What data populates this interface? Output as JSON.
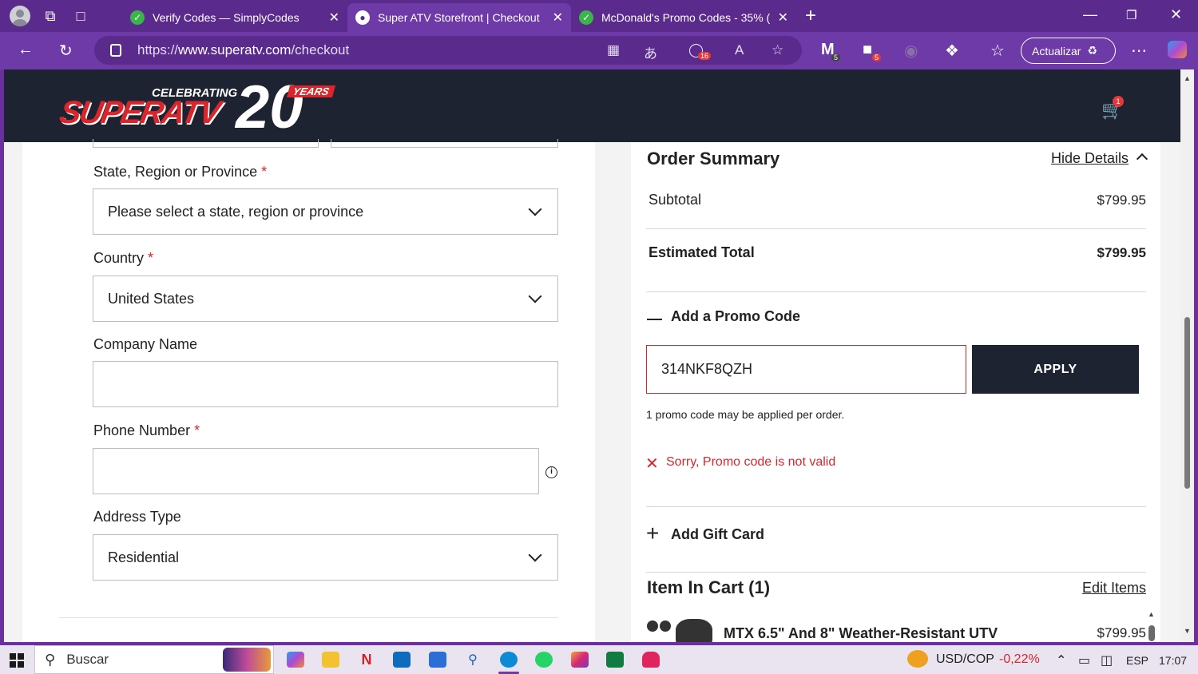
{
  "browser": {
    "tabs": [
      {
        "title": "Verify Codes — SimplyCodes",
        "active": false
      },
      {
        "title": "Super ATV Storefront | Checkout",
        "active": true
      },
      {
        "title": "McDonald's Promo Codes - 35% (",
        "active": false
      }
    ],
    "url_prefix": "https://",
    "url_domain": "www.superatv.com",
    "url_path": "/checkout",
    "coupon_badge": "16",
    "ext_badge_1": "5",
    "ext_badge_2": "5",
    "update_button": "Actualizar"
  },
  "header": {
    "logo_celebrating": "CELEBRATING",
    "logo_brand": "SUPERATV",
    "logo_number": "20",
    "logo_years": "YEARS",
    "cart_count": "1"
  },
  "form": {
    "state_label": "State, Region or Province",
    "state_value": "Please select a state, region or province",
    "country_label": "Country",
    "country_value": "United States",
    "company_label": "Company Name",
    "company_value": "",
    "phone_label": "Phone Number",
    "phone_value": "",
    "address_type_label": "Address Type",
    "address_type_value": "Residential",
    "required_mark": "*"
  },
  "summary": {
    "title": "Order Summary",
    "hide_details": "Hide Details",
    "subtotal_label": "Subtotal",
    "subtotal_value": "$799.95",
    "total_label": "Estimated Total",
    "total_value": "$799.95",
    "promo_heading": "Add a Promo Code",
    "promo_value": "314NKF8QZH",
    "apply_label": "APPLY",
    "promo_note": "1 promo code may be applied per order.",
    "promo_error": "Sorry, Promo code is not valid",
    "gift_heading": "Add Gift Card",
    "cart_heading": "Item In Cart (1)",
    "edit_items": "Edit Items",
    "item_name": "MTX 6.5\" And 8\" Weather-Resistant UTV",
    "item_price": "$799.95"
  },
  "taskbar": {
    "search_placeholder": "Buscar",
    "currency": "USD/COP",
    "currency_change": "-0,22%",
    "language": "ESP",
    "time": "17:07"
  },
  "colors": {
    "browser_frame": "#6d3aa8",
    "header_bg": "#1e2331",
    "accent_red": "#d9262c",
    "error_red": "#d9262c"
  }
}
